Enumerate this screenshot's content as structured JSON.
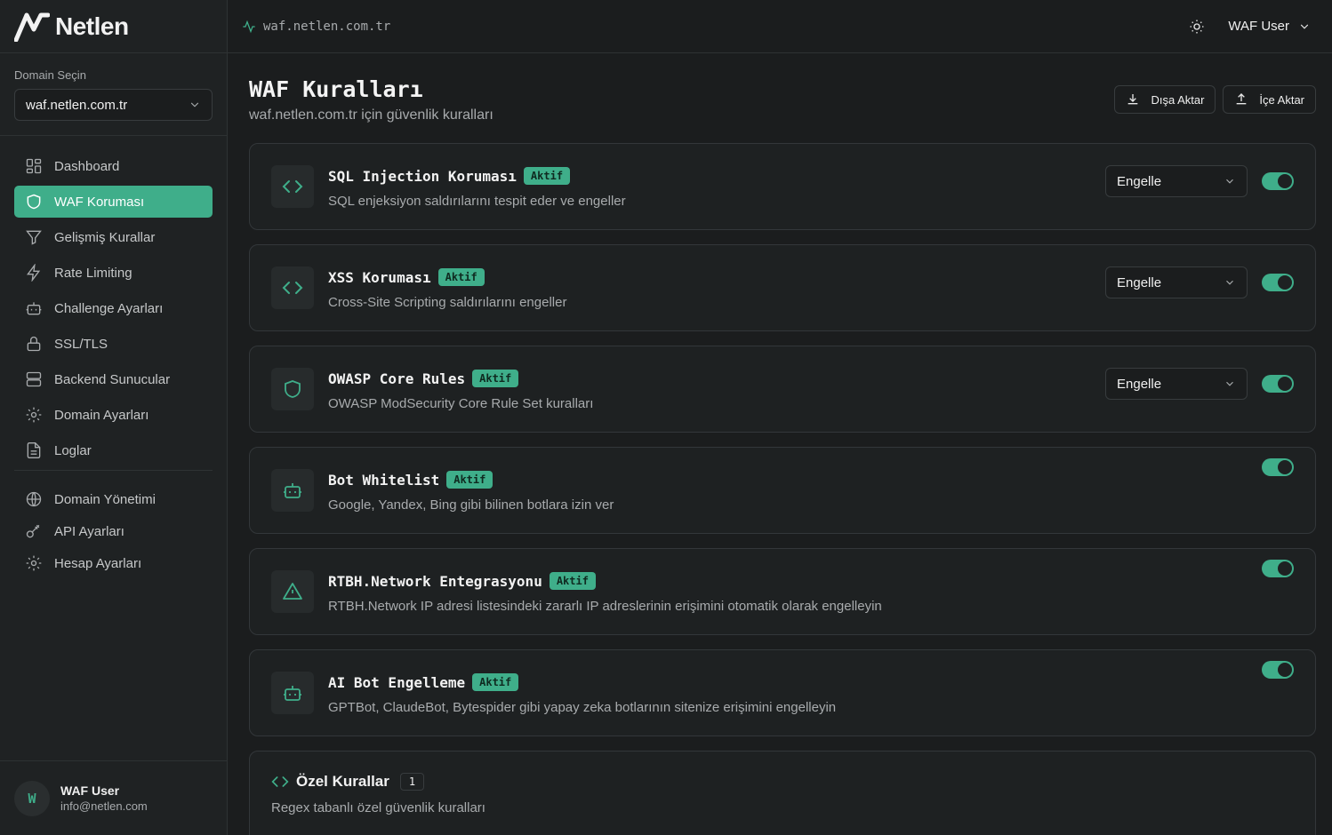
{
  "brand": {
    "name": "Netlen"
  },
  "sidebar": {
    "domain_label": "Domain Seçin",
    "domain_value": "waf.netlen.com.tr",
    "items": [
      {
        "label": "Dashboard",
        "icon": "grid-icon"
      },
      {
        "label": "WAF Koruması",
        "icon": "shield-icon",
        "active": true
      },
      {
        "label": "Gelişmiş Kurallar",
        "icon": "filter-icon"
      },
      {
        "label": "Rate Limiting",
        "icon": "bolt-icon"
      },
      {
        "label": "Challenge Ayarları",
        "icon": "robot-icon"
      },
      {
        "label": "SSL/TLS",
        "icon": "lock-icon"
      },
      {
        "label": "Backend Sunucular",
        "icon": "server-icon"
      },
      {
        "label": "Domain Ayarları",
        "icon": "gear-icon"
      },
      {
        "label": "Loglar",
        "icon": "file-icon"
      }
    ],
    "items2": [
      {
        "label": "Domain Yönetimi",
        "icon": "globe-icon"
      },
      {
        "label": "API Ayarları",
        "icon": "key-icon"
      },
      {
        "label": "Hesap Ayarları",
        "icon": "gear-icon"
      }
    ],
    "user": {
      "initial": "W",
      "name": "WAF User",
      "email": "info@netlen.com"
    }
  },
  "topbar": {
    "domain": "waf.netlen.com.tr",
    "user": "WAF User"
  },
  "page": {
    "title": "WAF Kuralları",
    "subtitle": "waf.netlen.com.tr için güvenlik kuralları",
    "export_label": "Dışa Aktar",
    "import_label": "İçe Aktar"
  },
  "rules": [
    {
      "title": "SQL Injection Koruması",
      "badge": "Aktif",
      "desc": "SQL enjeksiyon saldırılarını tespit eder ve engeller",
      "action": "Engelle",
      "enabled": true,
      "icon": "code-icon"
    },
    {
      "title": "XSS Koruması",
      "badge": "Aktif",
      "desc": "Cross-Site Scripting saldırılarını engeller",
      "action": "Engelle",
      "enabled": true,
      "icon": "code-icon"
    },
    {
      "title": "OWASP Core Rules",
      "badge": "Aktif",
      "desc": "OWASP ModSecurity Core Rule Set kuralları",
      "action": "Engelle",
      "enabled": true,
      "icon": "shield-icon"
    },
    {
      "title": "Bot Whitelist",
      "badge": "Aktif",
      "desc": "Google, Yandex, Bing gibi bilinen botlara izin ver",
      "enabled": true,
      "icon": "robot-icon"
    },
    {
      "title": "RTBH.Network Entegrasyonu",
      "badge": "Aktif",
      "desc": "RTBH.Network IP adresi listesindeki zararlı IP adreslerinin erişimini otomatik olarak engelleyin",
      "enabled": true,
      "icon": "warning-icon"
    },
    {
      "title": "AI Bot Engelleme",
      "badge": "Aktif",
      "desc": "GPTBot, ClaudeBot, Bytespider gibi yapay zeka botlarının sitenize erişimini engelleyin",
      "enabled": true,
      "icon": "robot-icon"
    }
  ],
  "custom_rules": {
    "title": "Özel Kurallar",
    "count": "1",
    "desc": "Regex tabanlı özel güvenlik kuralları"
  },
  "colors": {
    "accent": "#3fae8a",
    "bg": "#1b1d1e",
    "card": "#1e2122"
  }
}
